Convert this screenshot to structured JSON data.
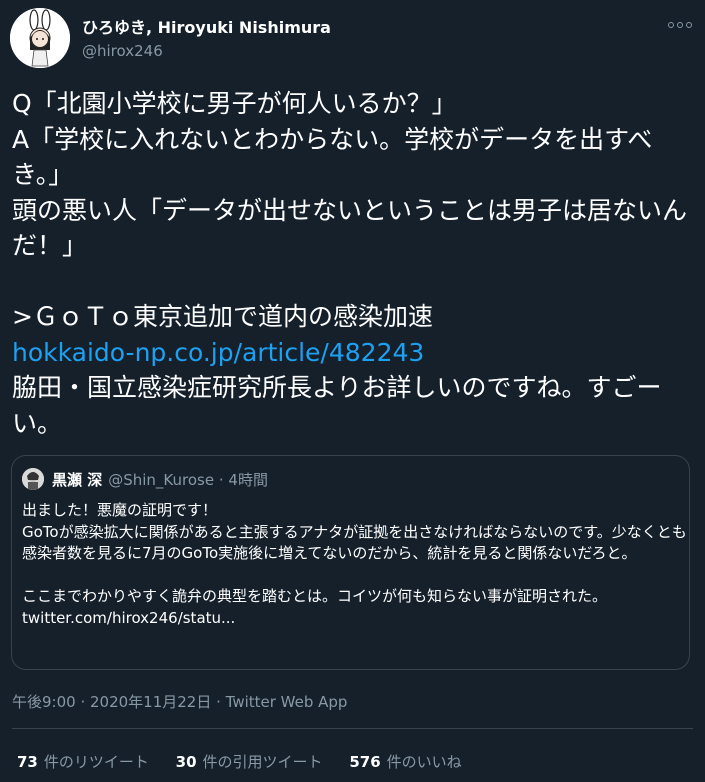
{
  "author": {
    "display_name": "ひろゆき, Hiroyuki Nishimura",
    "handle": "@hirox246"
  },
  "tweet": {
    "text": "Q「北園小学校に男子が何人いるか？」\nA「学校に入れないとわからない。学校がデータを出すべき。」\n頭の悪い人「データが出せないということは男子は居ないんだ！」\n\n>ＧｏＴｏ東京追加で道内の感染加速",
    "link": "hokkaido-np.co.jp/article/482243",
    "text_after": "脇田・国立感染症研究所長よりお詳しいのですね。すごーい。"
  },
  "quote": {
    "name": "黒瀬 深",
    "handle_time": "@Shin_Kurose · 4時間",
    "text": "出ました！悪魔の証明です！\nGoToが感染拡大に関係があると主張するアナタが証拠を出さなければならないのです。少なくとも感染者数を見るに7月のGoTo実施後に増えてないのだから、統計を見ると関係ないだろと。\n\nここまでわかりやすく詭弁の典型を踏むとは。コイツが何も知らない事が証明された。 twitter.com/hirox246/statu..."
  },
  "meta": "午後9:00 · 2020年11月22日 · Twitter Web App",
  "stats": {
    "retweets_count": "73",
    "retweets_label": "件のリツイート",
    "quotes_count": "30",
    "quotes_label": "件の引用ツイート",
    "likes_count": "576",
    "likes_label": "件のいいね"
  },
  "icons": {
    "more": "more-icon",
    "avatar": "avatar",
    "quote_avatar": "quote-avatar"
  }
}
